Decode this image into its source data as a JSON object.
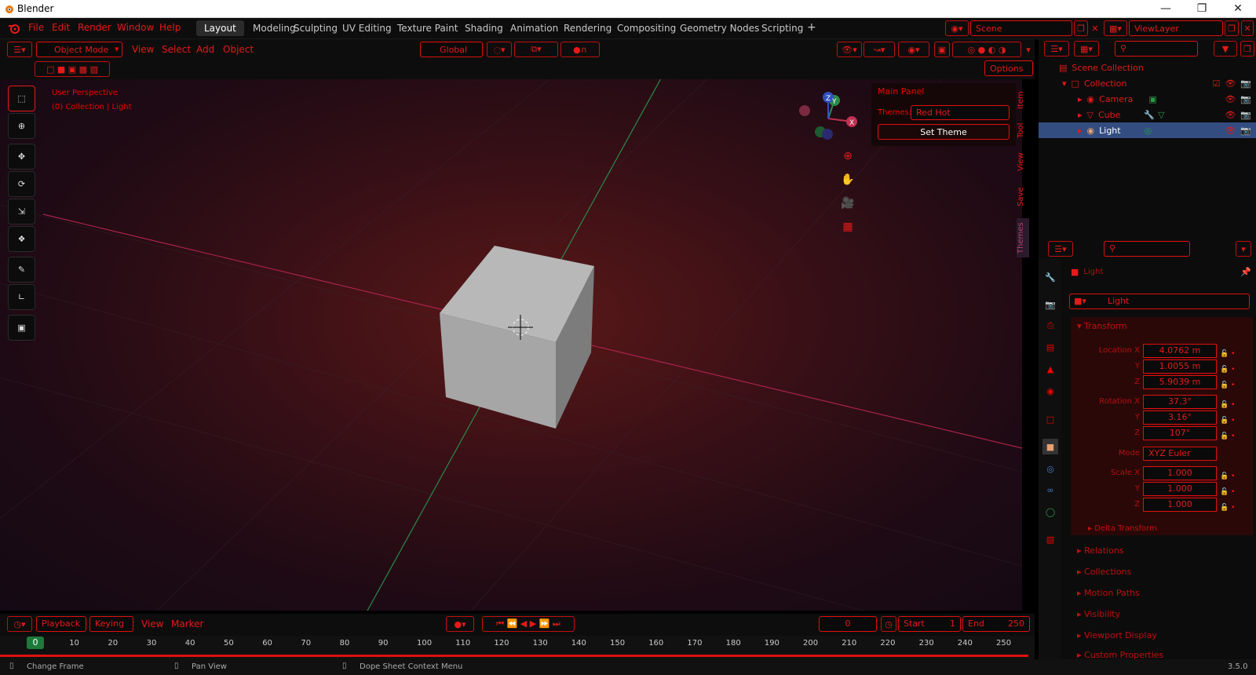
{
  "window": {
    "title": "Blender",
    "minimize_icon": "minimize-icon",
    "maximize_icon": "restore-icon",
    "close_icon": "close-icon"
  },
  "menu": [
    "File",
    "Edit",
    "Render",
    "Window",
    "Help"
  ],
  "workspaces": [
    "Layout",
    "Modeling",
    "Sculpting",
    "UV Editing",
    "Texture Paint",
    "Shading",
    "Animation",
    "Rendering",
    "Compositing",
    "Geometry Nodes",
    "Scripting",
    "+"
  ],
  "active_workspace": "Layout",
  "scene": {
    "name": "Scene",
    "view_layer": "ViewLayer"
  },
  "viewport_header": {
    "mode": "Object Mode",
    "menus": [
      "View",
      "Select",
      "Add",
      "Object"
    ],
    "orientation": "Global",
    "options_label": "Options"
  },
  "viewport": {
    "perspective": "User Perspective",
    "collection_info": "(0) Collection | Light",
    "gizmo_axes": [
      "X",
      "Y",
      "Z"
    ]
  },
  "npanel": {
    "title": "Main Panel",
    "themes_label": "Themes:",
    "theme_value": "Red Hot",
    "button": "Set Theme",
    "tabs": [
      "Item",
      "Tool",
      "View",
      "Save",
      "Themes"
    ]
  },
  "outliner": {
    "root": "Scene Collection",
    "items": [
      {
        "name": "Collection",
        "level": 1
      },
      {
        "name": "Camera",
        "level": 2
      },
      {
        "name": "Cube",
        "level": 2
      },
      {
        "name": "Light",
        "level": 2
      }
    ],
    "selected": "Light"
  },
  "properties": {
    "breadcrumb": "Light",
    "object_name": "Light",
    "transform_title": "Transform",
    "location_label": "Location X",
    "location": [
      "4.0762 m",
      "1.0055 m",
      "5.9039 m"
    ],
    "rotation_label": "Rotation X",
    "rotation": [
      "37.3°",
      "3.16°",
      "107°"
    ],
    "mode_label": "Mode",
    "mode_value": "XYZ Euler",
    "scale_label": "Scale X",
    "scale": [
      "1.000",
      "1.000",
      "1.000"
    ],
    "axis_y": "Y",
    "axis_z": "Z",
    "delta": "Delta Transform",
    "sections": [
      "Relations",
      "Collections",
      "Motion Paths",
      "Visibility",
      "Viewport Display",
      "Custom Properties"
    ]
  },
  "timeline": {
    "menus": [
      "Playback",
      "Keying",
      "View",
      "Marker"
    ],
    "current_frame": "0",
    "start_label": "Start",
    "start_value": "1",
    "end_label": "End",
    "end_value": "250",
    "ruler": [
      "0",
      "10",
      "20",
      "30",
      "40",
      "50",
      "60",
      "70",
      "80",
      "90",
      "100",
      "110",
      "120",
      "130",
      "140",
      "150",
      "160",
      "170",
      "180",
      "190",
      "200",
      "210",
      "220",
      "230",
      "240",
      "250"
    ]
  },
  "statusbar": {
    "items": [
      "Change Frame",
      "Pan View",
      "Dope Sheet Context Menu"
    ],
    "version": "3.5.0"
  },
  "colors": {
    "accent": "#e51a1a",
    "selected_row": "#334d80"
  }
}
